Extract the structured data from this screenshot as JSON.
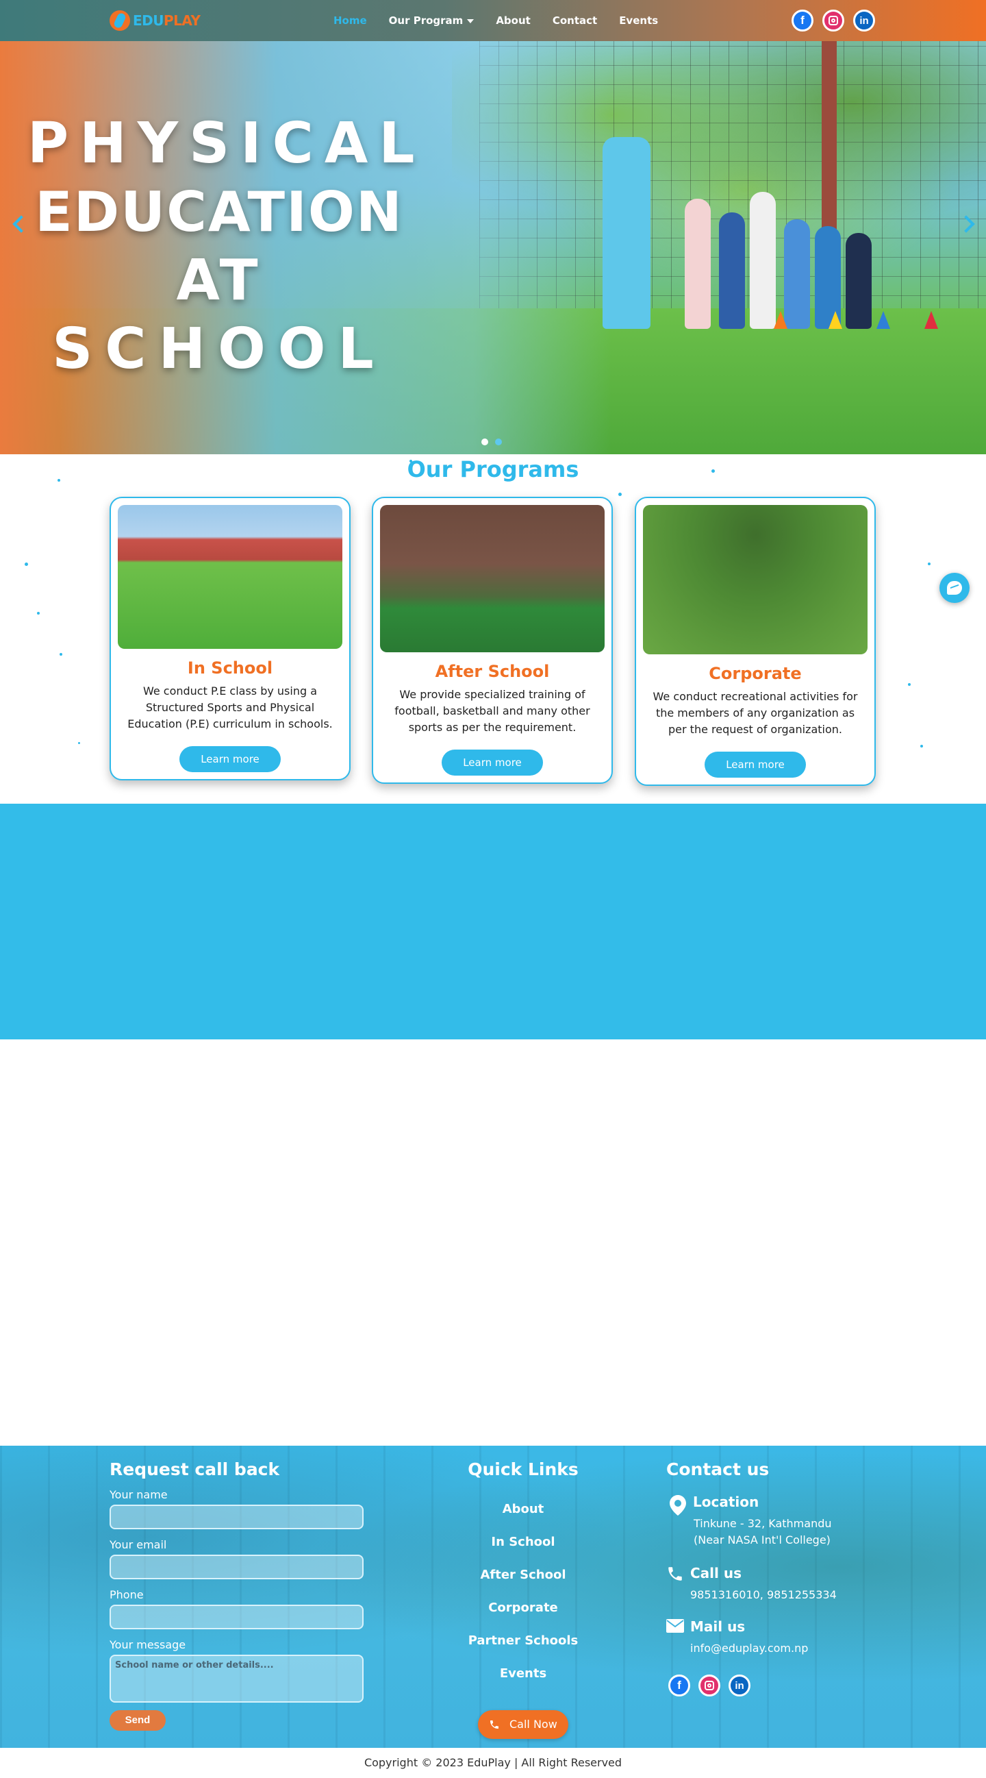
{
  "brand": {
    "logo_part1": "EDU",
    "logo_part2": "PLAY"
  },
  "nav": {
    "items": [
      {
        "label": "Home",
        "active": true
      },
      {
        "label": "Our Program",
        "dropdown": true
      },
      {
        "label": "About"
      },
      {
        "label": "Contact"
      },
      {
        "label": "Events"
      }
    ],
    "social": [
      "facebook-icon",
      "instagram-icon",
      "linkedin-icon"
    ]
  },
  "hero": {
    "title_lines": [
      "PHYSICAL",
      "EDUCATION",
      "AT",
      "SCHOOL"
    ],
    "slide_count": 2,
    "active_slide": 1
  },
  "programs": {
    "title": "Our Programs",
    "cards": [
      {
        "title": "In School",
        "desc": "We conduct P.E class by using a Structured Sports and Physical Education (P.E) curriculum in schools.",
        "button": "Learn more"
      },
      {
        "title": "After School",
        "desc": "We provide specialized training of football, basketball and many other sports as per the requirement.",
        "button": "Learn more"
      },
      {
        "title": "Corporate",
        "desc": "We conduct recreational activities for the members of any organization as per the request of organization.",
        "button": "Learn more"
      }
    ]
  },
  "footer": {
    "request": {
      "title": "Request call back",
      "name_label": "Your name",
      "email_label": "Your email",
      "phone_label": "Phone",
      "message_label": "Your message",
      "message_placeholder": "School name or other details....",
      "send": "Send"
    },
    "quick_links": {
      "title": "Quick Links",
      "items": [
        "About",
        "In School",
        "After School",
        "Corporate",
        "Partner Schools",
        "Events"
      ],
      "call_now": "Call Now"
    },
    "contact": {
      "title": "Contact us",
      "location_title": "Location",
      "location_line1": "Tinkune - 32, Kathmandu",
      "location_line2": "(Near NASA Int'l College)",
      "call_title": "Call us",
      "call_numbers": "9851316010, 9851255334",
      "mail_title": "Mail us",
      "mail_address": "info@eduplay.com.np"
    }
  },
  "copyright": "Copyright © 2023 EduPlay | All Right Reserved",
  "colors": {
    "primary": "#2fb9ea",
    "accent": "#f07024"
  }
}
